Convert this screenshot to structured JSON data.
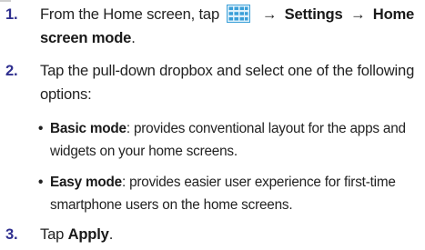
{
  "steps": [
    {
      "number": "1.",
      "prefix": "From the Home screen, tap",
      "icon": "apps-grid-icon",
      "path_1": "Settings",
      "path_2": "Home screen mode",
      "suffix": ".",
      "arrow": "→"
    },
    {
      "number": "2.",
      "text": "Tap the pull-down dropbox and select one of the following options:",
      "options": [
        {
          "bullet": "•",
          "term": "Basic mode",
          "description": ": provides conventional layout for the apps and widgets on your home screens."
        },
        {
          "bullet": "•",
          "term": "Easy mode",
          "description": ": provides easier user experience for first-time smartphone users on the home screens."
        }
      ]
    },
    {
      "number": "3.",
      "prefix": "Tap",
      "action": "Apply",
      "suffix": "."
    }
  ],
  "colors": {
    "number": "#2f2f8f",
    "icon_blue": "#3a9fd8",
    "icon_light": "#dff1fb"
  }
}
